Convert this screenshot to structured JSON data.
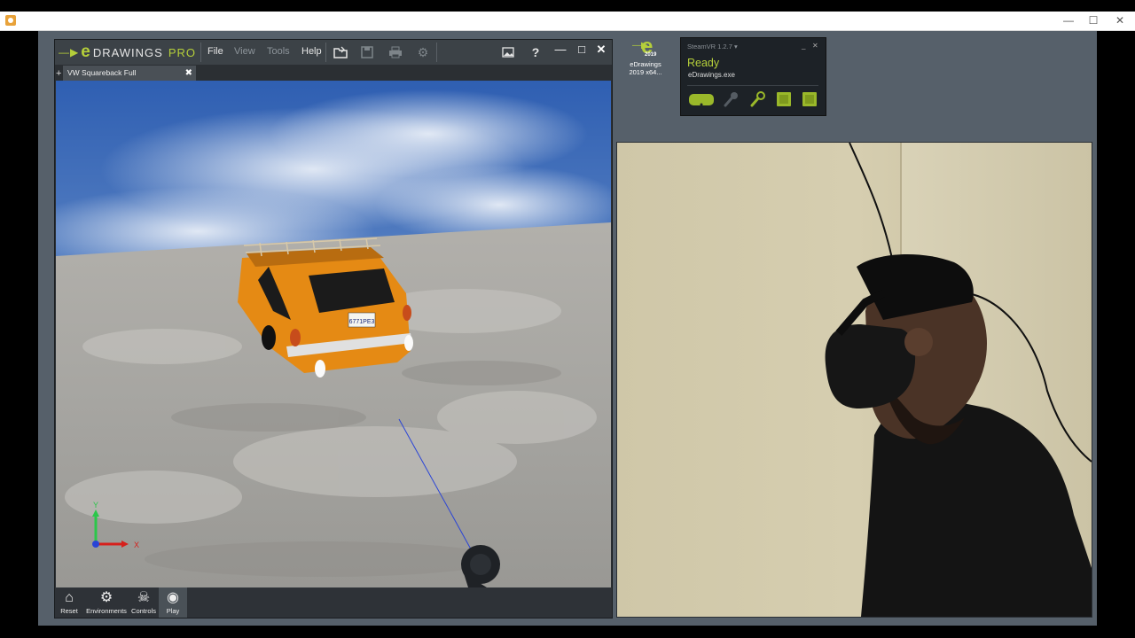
{
  "edrawings": {
    "logo": {
      "brand": "DRAWINGS",
      "edition": "PRO"
    },
    "menus": [
      {
        "label": "File",
        "enabled": true
      },
      {
        "label": "View",
        "enabled": false
      },
      {
        "label": "Tools",
        "enabled": false
      },
      {
        "label": "Help",
        "enabled": true
      }
    ],
    "toolbar_icons": [
      "open-icon",
      "save-icon",
      "print-icon",
      "options-icon",
      "image-icon",
      "help-icon"
    ],
    "help_glyph": "?",
    "tab": {
      "label": "VW Squareback Full Assembly.SLDASM"
    },
    "bottom_buttons": [
      {
        "label": "Reset",
        "icon": "home-icon"
      },
      {
        "label": "Environments",
        "icon": "gear-icon"
      },
      {
        "label": "Controls",
        "icon": "controls-icon"
      },
      {
        "label": "Play",
        "icon": "play-headset-icon"
      }
    ],
    "scene": {
      "license_plate": "6771PE3",
      "axis_x_label": "X",
      "axis_y_label": "Y",
      "car_color": "#f09a1c",
      "sky_color": "#2f5fb2"
    }
  },
  "desktop_icon": {
    "label_line1": "eDrawings",
    "label_line2": "2019 x64...",
    "year": "2019"
  },
  "steamvr": {
    "title": "SteamVR 1.2.7 ▾",
    "status": "Ready",
    "app": "eDrawings.exe",
    "devices": [
      "headset-icon",
      "microphone-icon",
      "controller-icon",
      "base-station-icon",
      "base-station-icon"
    ],
    "accent": "#b5cf3a"
  },
  "outer_window": {
    "controls": [
      "minimize",
      "maximize",
      "close"
    ]
  }
}
